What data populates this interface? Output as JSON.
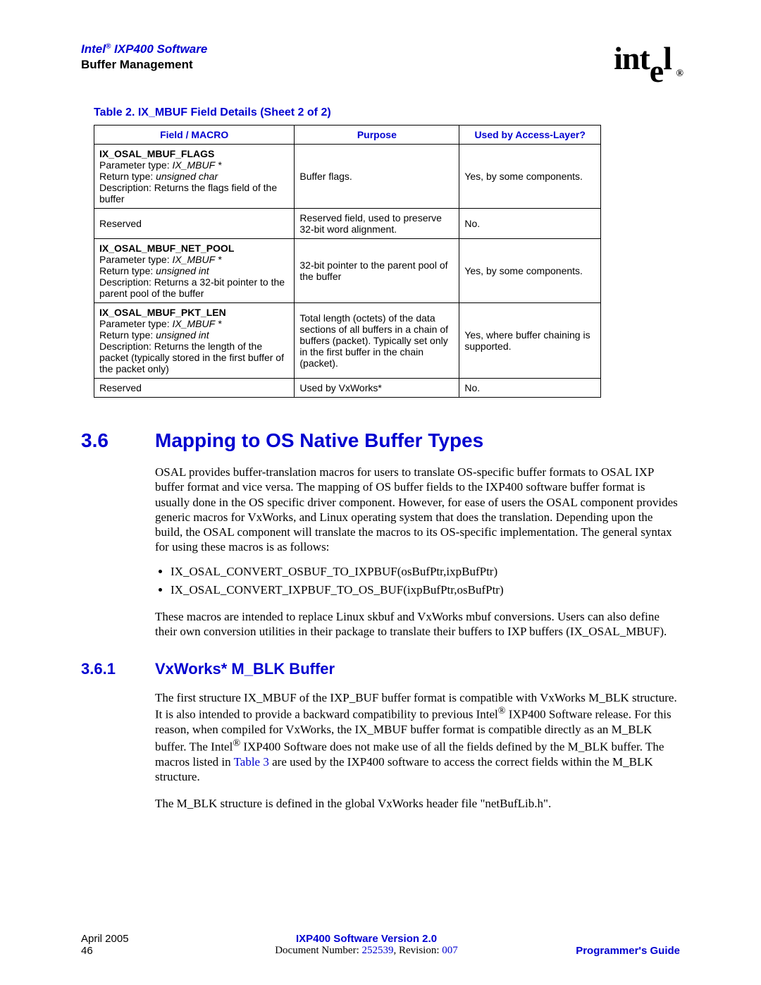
{
  "header": {
    "title_prefix": "Intel",
    "title_reg": "®",
    "title_suffix": " IXP400 Software",
    "subtitle": "Buffer Management",
    "logo_text": "intel",
    "logo_reg": "®"
  },
  "table": {
    "caption": "Table 2.   IX_MBUF Field Details (Sheet 2 of 2)",
    "headers": [
      "Field / MACRO",
      "Purpose",
      "Used by Access-Layer?"
    ],
    "rows": [
      {
        "macro": "IX_OSAL_MBUF_FLAGS",
        "param_label": "Parameter type: ",
        "param_type": "IX_MBUF *",
        "return_label": "Return type: ",
        "return_type": "unsigned char",
        "desc": "Description: Returns the flags field of the buffer",
        "purpose": "Buffer flags.",
        "used": "Yes, by some components."
      },
      {
        "macro": "Reserved",
        "plain": true,
        "purpose": "Reserved field, used to preserve 32-bit word alignment.",
        "used": "No."
      },
      {
        "macro": "IX_OSAL_MBUF_NET_POOL",
        "param_label": "Parameter type: ",
        "param_type": "IX_MBUF *",
        "return_label": "Return type: ",
        "return_type": "unsigned int",
        "desc": "Description: Returns a 32-bit pointer to the parent pool of the buffer",
        "purpose": "32-bit pointer to the parent pool of the buffer",
        "used": "Yes, by some components."
      },
      {
        "macro": "IX_OSAL_MBUF_PKT_LEN",
        "param_label": "Parameter type: ",
        "param_type": "IX_MBUF *",
        "return_label": "Return type: ",
        "return_type": "unsigned int",
        "desc": "Description: Returns the length of the packet (typically stored in the first buffer of the packet only)",
        "purpose": "Total length (octets) of the data sections of all buffers in a chain of buffers (packet). Typically set only in the first buffer in the chain (packet).",
        "used": "Yes, where buffer chaining is supported."
      },
      {
        "macro": "Reserved",
        "plain": true,
        "purpose": "Used by VxWorks*",
        "used": "No."
      }
    ]
  },
  "section36": {
    "num": "3.6",
    "title": "Mapping to OS Native Buffer Types",
    "para1": "OSAL provides buffer-translation macros for users to translate OS-specific buffer formats to OSAL IXP buffer format and vice versa. The mapping of OS buffer fields to the IXP400 software buffer format is usually done in the OS specific driver component. However, for ease of users the OSAL component provides generic macros for VxWorks, and Linux operating system that does the translation. Depending upon the build, the OSAL component will translate the macros to its OS-specific implementation. The general syntax for using these macros is as follows:",
    "bullets": [
      "IX_OSAL_CONVERT_OSBUF_TO_IXPBUF(osBufPtr,ixpBufPtr)",
      "IX_OSAL_CONVERT_IXPBUF_TO_OS_BUF(ixpBufPtr,osBufPtr)"
    ],
    "para2": "These macros are intended to replace Linux skbuf and VxWorks mbuf conversions. Users can also define their own conversion utilities in their package to translate their buffers to IXP buffers (IX_OSAL_MBUF)."
  },
  "section361": {
    "num": "3.6.1",
    "title": "VxWorks* M_BLK Buffer",
    "para1a": "The first structure IX_MBUF of the IXP_BUF buffer format is compatible with VxWorks M_BLK structure. It is also intended to provide a backward compatibility to previous Intel",
    "para1reg": "®",
    "para1b": " IXP400 Software release. For this reason, when compiled for VxWorks, the IX_MBUF buffer format is compatible directly as an M_BLK buffer. The Intel",
    "para1c": " IXP400 Software does not make use of all the fields defined by the M_BLK buffer. The macros listed in ",
    "table3_ref": "Table 3",
    "para1d": " are used by the IXP400 software to access the correct fields within the M_BLK structure.",
    "para2": "The M_BLK structure is defined in the global VxWorks header file \"netBufLib.h\"."
  },
  "footer": {
    "date": "April 2005",
    "page": "46",
    "center1": "IXP400 Software Version 2.0",
    "center2a": "Document Number: ",
    "docnum": "252539",
    "center2b": ", Revision: ",
    "rev": "007",
    "right": "Programmer's Guide"
  }
}
